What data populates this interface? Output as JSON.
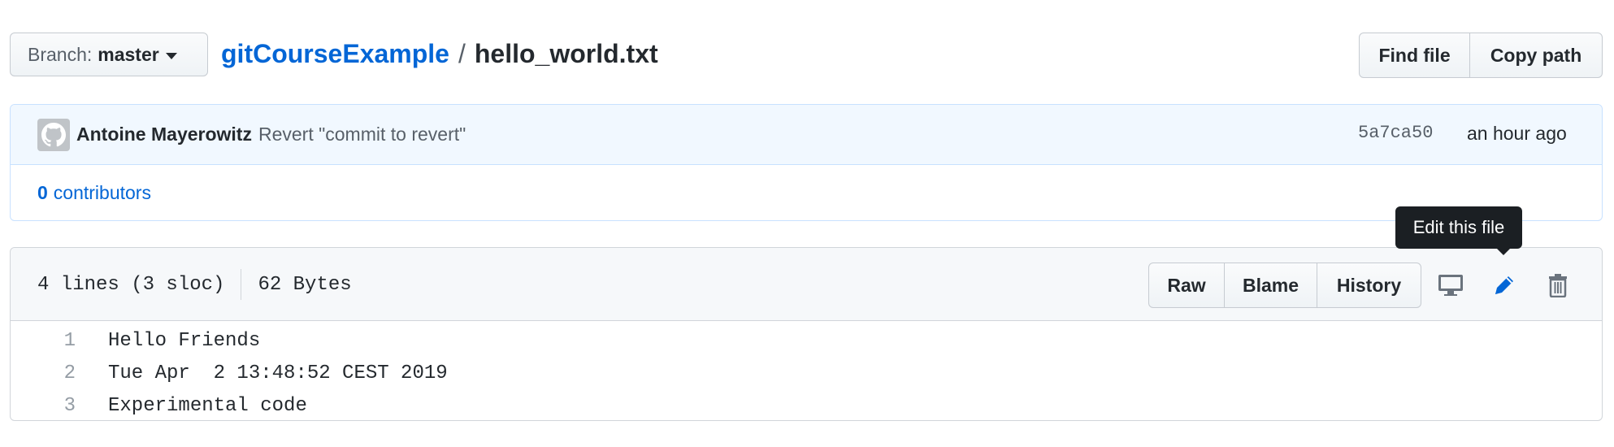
{
  "header": {
    "branch_prefix": "Branch:",
    "branch_name": "master",
    "repo_name": "gitCourseExample",
    "separator": "/",
    "file_name": "hello_world.txt",
    "find_file_label": "Find file",
    "copy_path_label": "Copy path"
  },
  "commit": {
    "author": "Antoine Mayerowitz",
    "message": "Revert \"commit to revert\"",
    "sha": "5a7ca50",
    "time": "an hour ago",
    "contributors_count": "0",
    "contributors_label": "contributors"
  },
  "file": {
    "lines_info": "4 lines (3 sloc)",
    "size": "62 Bytes",
    "raw_label": "Raw",
    "blame_label": "Blame",
    "history_label": "History",
    "tooltip": "Edit this file",
    "icons": [
      "desktop-icon",
      "pencil-icon",
      "trash-icon"
    ],
    "lines": [
      {
        "num": "1",
        "text": "Hello Friends"
      },
      {
        "num": "2",
        "text": "Tue Apr  2 13:48:52 CEST 2019"
      },
      {
        "num": "3",
        "text": "Experimental code"
      }
    ]
  },
  "colors": {
    "link": "#0366d6",
    "commit_bg": "#f1f8ff",
    "header_bg": "#f6f8fa",
    "tooltip_bg": "#1b1f23"
  }
}
